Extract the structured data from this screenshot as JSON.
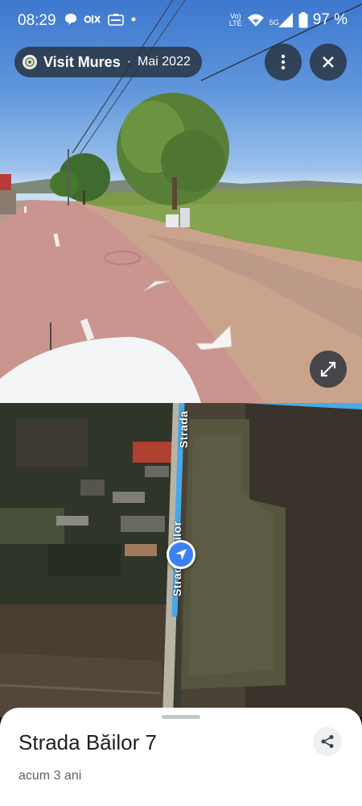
{
  "status_bar": {
    "time": "08:29",
    "left_icons": [
      "chat-bubble-icon",
      "olx-app-icon",
      "emag-app-icon",
      "dot-icon"
    ],
    "network_label_top": "Vo)",
    "network_label_bottom": "LTE",
    "signal_label": "5G",
    "battery_percent": "97 %"
  },
  "header": {
    "title": "Visit Mures",
    "separator": "·",
    "date": "Mai 2022",
    "menu_icon": "more-vert-icon",
    "close_icon": "close-icon"
  },
  "street_view": {
    "expand_icon": "expand-icon",
    "nav_arrow_icons": [
      "chevron-forward-icon",
      "chevron-back-icon"
    ]
  },
  "map": {
    "street_label_top": "Strada",
    "street_label_bottom": "Strada Băilor",
    "marker_icon": "navigation-arrow-icon",
    "route_color": "#4aa8e8"
  },
  "sheet": {
    "title": "Strada Băilor 7",
    "subtitle": "acum 3 ani",
    "share_icon": "share-icon"
  }
}
